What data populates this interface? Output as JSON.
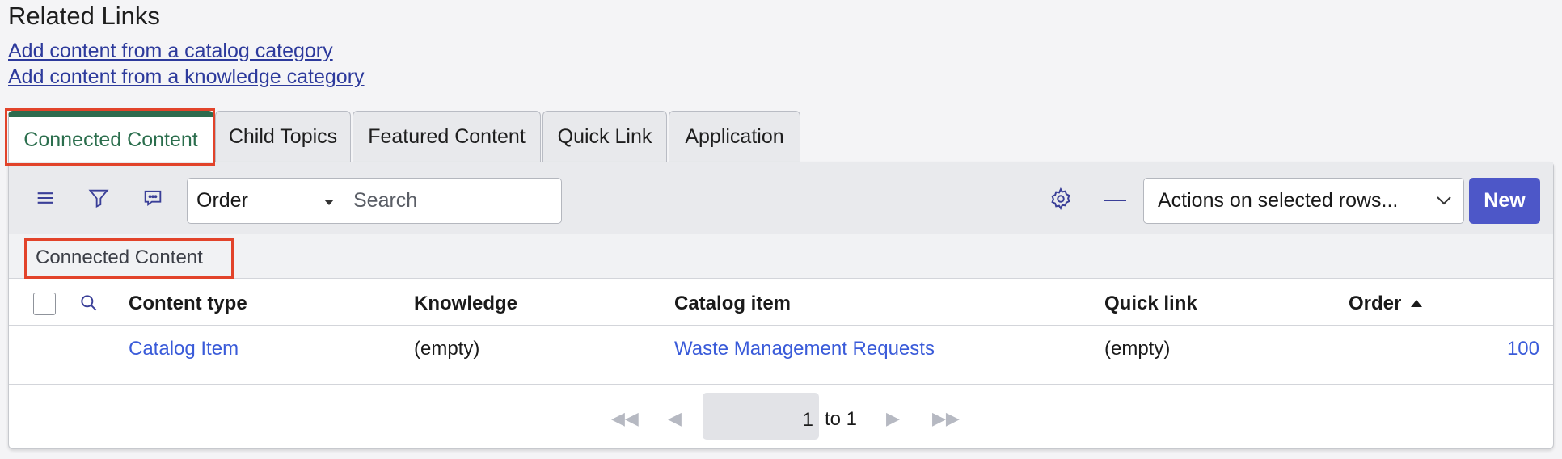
{
  "related_links": {
    "heading": "Related Links",
    "links": [
      "Add content from a catalog category",
      "Add content from a knowledge category"
    ]
  },
  "tabs": [
    "Connected Content",
    "Child Topics",
    "Featured Content",
    "Quick Link",
    "Application"
  ],
  "active_tab": "Connected Content",
  "toolbar": {
    "menu_icon": "hamburger-menu-icon",
    "filter_icon": "funnel-filter-icon",
    "activity_icon": "chat-bubble-icon",
    "search_field_select": "Order",
    "search_placeholder": "Search",
    "settings_icon": "gear-icon",
    "collapse_icon": "minus-icon",
    "actions_select": "Actions on selected rows...",
    "new_button": "New"
  },
  "list_title": "Connected Content",
  "table": {
    "columns": [
      "Content type",
      "Knowledge",
      "Catalog item",
      "Quick link",
      "Order"
    ],
    "sorted_column": "Order",
    "rows": [
      {
        "content_type": "Catalog Item",
        "knowledge": "(empty)",
        "catalog_item": "Waste Management Requests",
        "quick_link": "(empty)",
        "order": "100"
      }
    ]
  },
  "pagination": {
    "current": "1",
    "of_text": "to 1"
  },
  "colors": {
    "active_tab": "#2e6b4e",
    "primary_button": "#4d57c8",
    "link": "#3a5bd9",
    "highlight": "#e2432a"
  }
}
